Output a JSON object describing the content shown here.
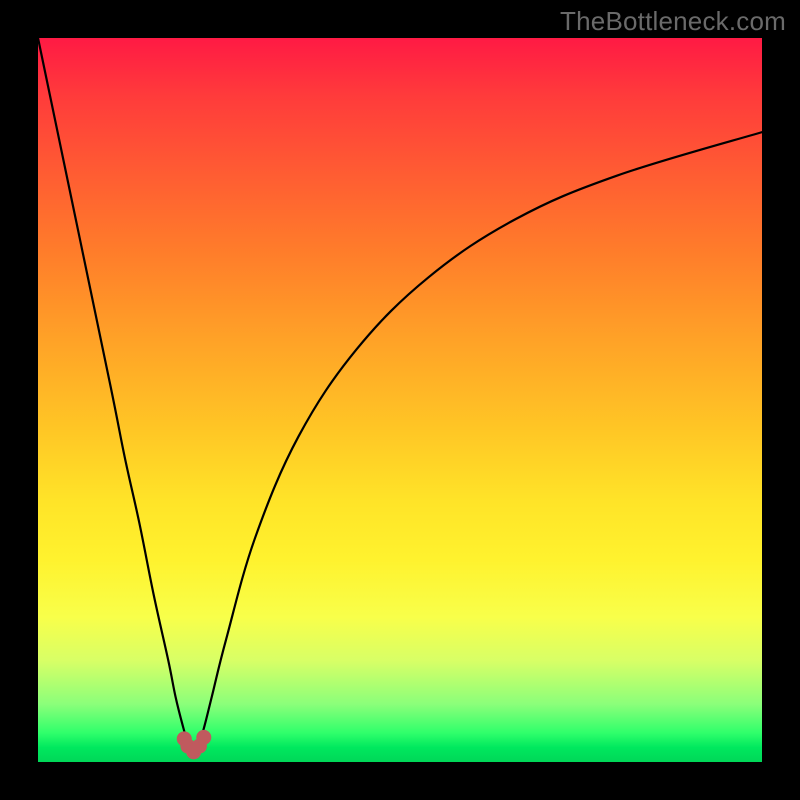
{
  "attribution": "TheBottleneck.com",
  "chart_data": {
    "type": "line",
    "title": "",
    "xlabel": "",
    "ylabel": "",
    "x": [
      0,
      5,
      10,
      12,
      14,
      16,
      18,
      19,
      20,
      20.75,
      21.5,
      22.25,
      23,
      24,
      26,
      30,
      36,
      44,
      54,
      66,
      80,
      100
    ],
    "values": [
      100,
      76,
      52,
      42,
      33,
      23,
      14,
      9,
      5,
      2.5,
      1.2,
      2.5,
      5,
      9,
      17,
      31,
      45,
      57,
      67,
      75,
      81,
      87
    ],
    "xlim": [
      0,
      100
    ],
    "ylim": [
      0,
      100
    ],
    "annotations": {
      "min_x": 21.5,
      "min_y": 1.2,
      "min_marker_points": [
        {
          "x": 20.2,
          "y": 3.2
        },
        {
          "x": 20.7,
          "y": 2.2
        },
        {
          "x": 21.5,
          "y": 1.4
        },
        {
          "x": 22.3,
          "y": 2.2
        },
        {
          "x": 22.9,
          "y": 3.4
        }
      ]
    }
  }
}
